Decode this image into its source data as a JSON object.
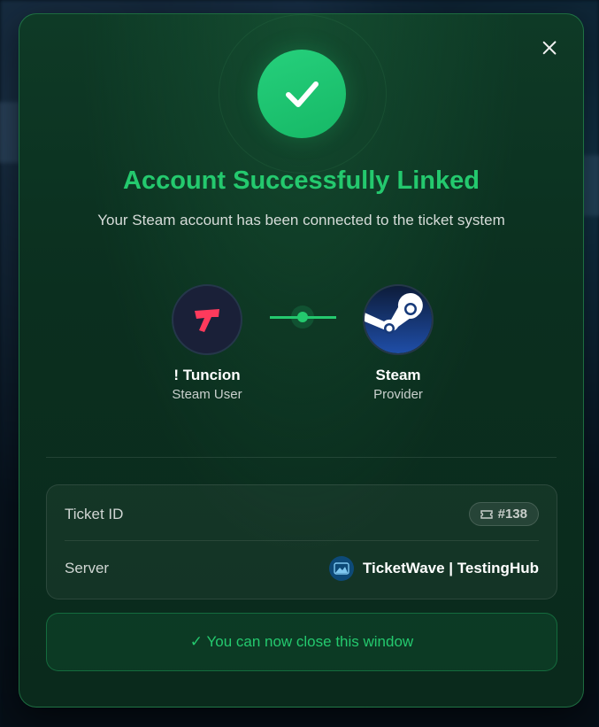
{
  "modal": {
    "close_icon": "close-icon",
    "status_icon": "checkmark-icon",
    "title": "Account Successfully Linked",
    "subtitle": "Your Steam account has been connected to the ticket system",
    "user": {
      "name": "! Tuncion",
      "role": "Steam User",
      "icon": "user-logo-icon"
    },
    "provider": {
      "name": "Steam",
      "role": "Provider",
      "icon": "steam-logo-icon"
    },
    "details": {
      "ticket_label": "Ticket ID",
      "ticket_value": "#138",
      "ticket_icon": "ticket-icon",
      "server_label": "Server",
      "server_value": "TicketWave | TestingHub",
      "server_icon": "server-avatar-icon"
    },
    "footer_note": "✓ You can now close this window"
  },
  "colors": {
    "accent": "#24c96e",
    "background": "#0b2f1f",
    "user_logo": "#ff3a5c",
    "steam_blue": "#1b3a8a"
  }
}
